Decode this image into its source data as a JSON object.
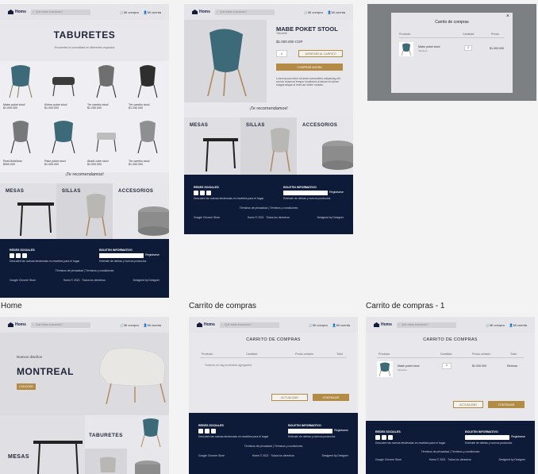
{
  "nav": {
    "brand": "Homs",
    "search_placeholder": "Qué estás buscando?",
    "cart": "Mi compra",
    "account": "Mi cuenta"
  },
  "labels": {
    "home": "Home",
    "cart": "Carrito de compras",
    "cart1": "Carrito de compras - 1"
  },
  "taburetes": {
    "title": "TABURETES",
    "subtitle": "Encuentra la comodidad en diferentes espacios",
    "products": [
      {
        "name": "Mabe poket stool",
        "price": "$1.000.000"
      },
      {
        "name": "Kleine poket stool",
        "price": "$1.000.000"
      },
      {
        "name": "Tre cambio stool",
        "price": "$1.250.000"
      },
      {
        "name": "Tre cambio stool",
        "price": "$1.250.000"
      },
      {
        "name": "Real Mobiliario",
        "price": "$900.000"
      },
      {
        "name": "Pake poket stool",
        "price": "$1.000.000"
      },
      {
        "name": "Abadi cube stool",
        "price": "$1.000.000"
      },
      {
        "name": "Tre cambio stool",
        "price": "$1.250.000"
      }
    ],
    "recommend": "¡Te recomendamos!"
  },
  "categories": {
    "mesas": "MESAS",
    "sillas": "SILLAS",
    "accesorios": "ACCESORIOS",
    "taburetes": "TABURETES"
  },
  "footer": {
    "social": "REDES SOCIALES",
    "social_text": "Descubre las nuevas tendencias en muebles para el hogar",
    "newsletter": "BOLETIN INFORMATIVO",
    "subscribe": "Registrarse",
    "newsletter_text": "Entérate de ofertas y nuevos productos",
    "links": "Términos de privacidad  |  Términos y condiciones",
    "f1": "Google Chrome Store",
    "f2": "Homs © 2021 · Todos los derechos",
    "f3": "Designed by Designer"
  },
  "detail": {
    "title": "MABE POKET STOOL",
    "sub": "Taburete",
    "price": "$1.000.000 COP",
    "qty": "1",
    "add_cart": "AGREGAR AL CARRITO",
    "buy": "COMPRAR AHORA",
    "desc": "Lorem ipsum dolor sit amet consectetur adipiscing elit sed do eiusmod tempor incididunt ut labore et dolore magna aliqua ut enim ad minim veniam."
  },
  "modal": {
    "title": "Carrito de compras",
    "close": "×",
    "col_product": "Producto",
    "col_qty": "Cantidad",
    "col_price": "Precio",
    "item": "Mabe poket stool",
    "item_sub": "Taburete",
    "qty": "1",
    "price": "$1.000.000"
  },
  "home": {
    "small": "Nuevos diseños",
    "title": "MONTREAL",
    "cta": "CONOCER"
  },
  "cart": {
    "title": "CARRITO DE COMPRAS",
    "col_product": "Producto",
    "col_qty": "Cantidad",
    "col_unit": "Precio unitario",
    "col_total": "Total",
    "empty": "Todavía no hay productos agregados",
    "update": "ACTUALIZAR",
    "checkout": "CONTINUAR"
  },
  "cart1": {
    "title": "CARRITO DE COMPRAS",
    "col_product": "Producto",
    "col_qty": "Cantidad",
    "col_unit": "Precio unitario",
    "col_total": "Total",
    "item": "Mabe poket stool",
    "item_sub": "Taburete",
    "qty": "1",
    "price": "$1.000.000",
    "remove": "Eliminar",
    "update": "ACTUALIZAR",
    "checkout": "CONTINUAR"
  }
}
